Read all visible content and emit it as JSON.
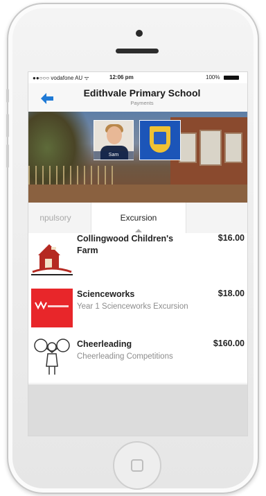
{
  "status_bar": {
    "carrier": "●●○○○ vodafone AU ᯤ",
    "time": "12:06 pm",
    "battery": "100%"
  },
  "navbar": {
    "title": "Edithvale Primary School",
    "subtitle": "Payments"
  },
  "hero": {
    "student_label": "Sam"
  },
  "tabs": [
    {
      "label": "npulsory"
    },
    {
      "label": "Excursion"
    }
  ],
  "items": [
    {
      "title": "Collingwood Children's Farm",
      "price": "$16.00",
      "description": ""
    },
    {
      "title": "Scienceworks",
      "price": "$18.00",
      "description": "Year 1 Scienceworks Excursion"
    },
    {
      "title": "Cheerleading",
      "price": "$160.00",
      "description": "Cheerleading Competitions"
    }
  ],
  "colors": {
    "accent_blue": "#1f7ad6",
    "scienceworks_red": "#e8262a",
    "farm_red": "#b52a22"
  }
}
